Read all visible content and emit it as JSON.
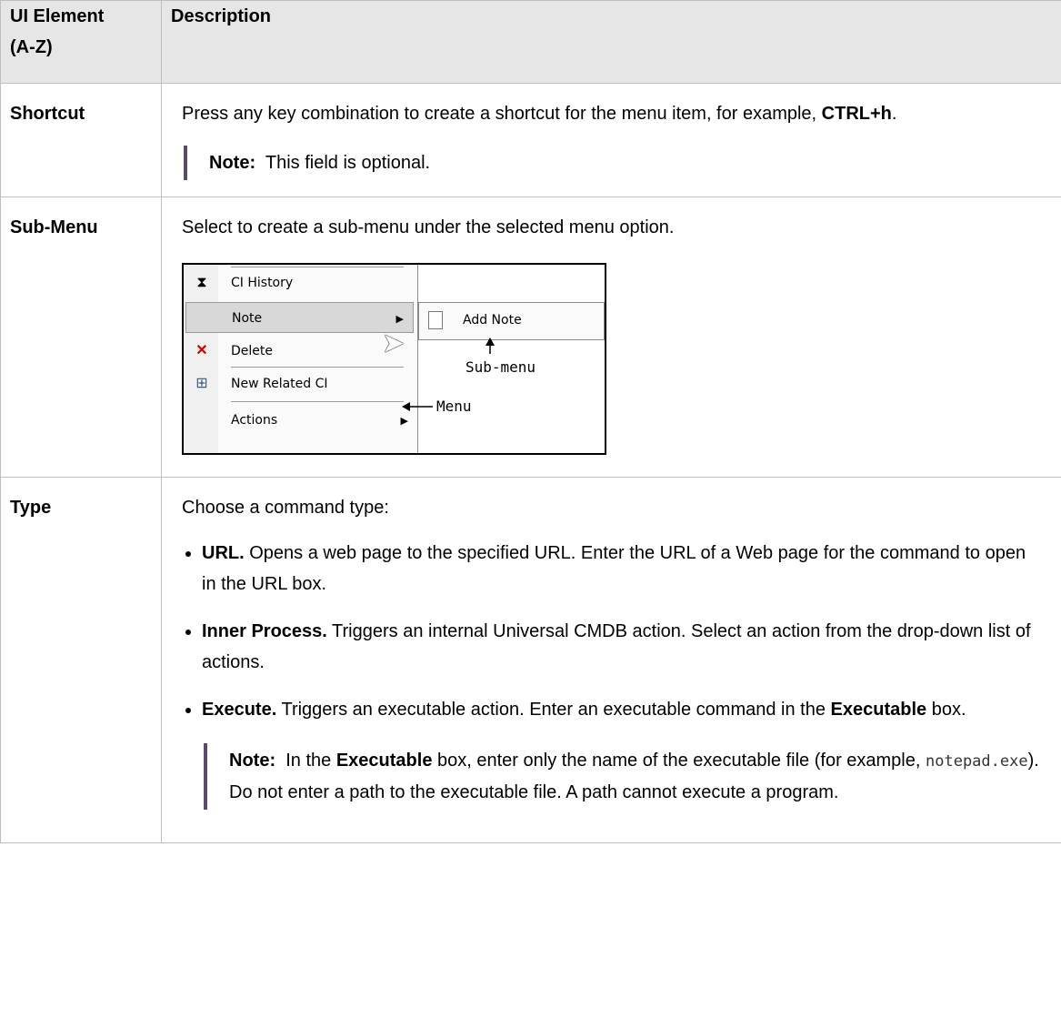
{
  "table": {
    "header_col1_line1": "UI Element",
    "header_col1_line2": "(A-Z)",
    "header_col2": "Description"
  },
  "rows": {
    "shortcut": {
      "name": "Shortcut",
      "text": "Press any key combination to create a shortcut for the menu item, for example,",
      "example": "CTRL+h",
      "period": ".",
      "note_label": "Note:",
      "note_text": "This field is optional."
    },
    "submenu": {
      "name": "Sub-Menu",
      "text": "Select to create a sub-menu under the selected menu option.",
      "screenshot": {
        "items": [
          "CI History",
          "Note",
          "Delete",
          "New Related CI",
          "Actions"
        ],
        "sub_item": "Add Note",
        "callout_sub": "Sub-menu",
        "callout_menu": "Menu"
      }
    },
    "type": {
      "name": "Type",
      "intro": "Choose a command type:",
      "url_label": "URL.",
      "url_text": "Opens a web page to the specified URL. Enter the URL of a Web page for the command to open in the URL box.",
      "inner_label": "Inner Process.",
      "inner_text": "Triggers an internal Universal CMDB action. Select an action from the drop-down list of actions.",
      "exec_label": "Execute.",
      "exec_text": "Triggers an executable action. Enter an executable command in the",
      "exec_box": "Executable",
      "exec_box_suffix": "box.",
      "note_label": "Note:",
      "note_pre": "In the",
      "note_box": "Executable",
      "note_mid": "box, enter only the name of the executable file (for example,",
      "note_code": "notepad.exe",
      "note_post": "). Do not enter a path to the executable file. A path cannot execute a program."
    }
  },
  "icons": {
    "ci_history": "hourglass-icon",
    "delete": "red-x-icon",
    "new_related_ci": "grid-icon",
    "add_note": "page-icon",
    "cursor": "mouse-pointer-icon"
  },
  "colors": {
    "header_bg": "#e6e6e6",
    "note_bar": "#5c4a6b",
    "delete_icon": "#d00000"
  }
}
